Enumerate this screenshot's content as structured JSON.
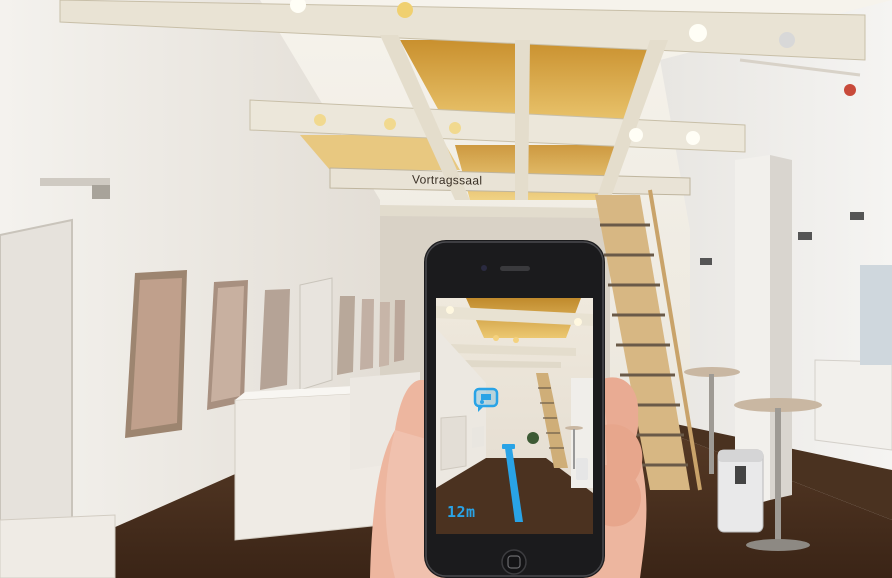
{
  "scene": {
    "sign_text": "Vortragssaal"
  },
  "ar_view": {
    "distance_label": "12m",
    "accent_color": "#29a3e6",
    "marker_icon": "presentation-icon"
  }
}
